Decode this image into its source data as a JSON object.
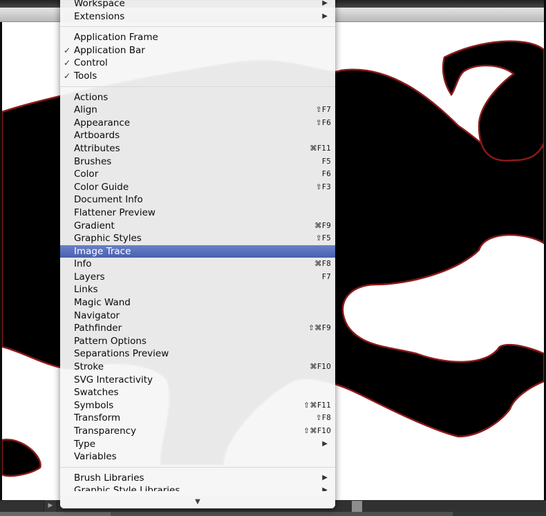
{
  "window": {
    "status_arrow_icon": "▶"
  },
  "menu": {
    "groups": [
      [
        {
          "label": "Workspace",
          "submenu": true
        },
        {
          "label": "Extensions",
          "submenu": true
        }
      ],
      [
        {
          "label": "Application Frame",
          "checked": false
        },
        {
          "label": "Application Bar",
          "checked": true
        },
        {
          "label": "Control",
          "checked": true
        },
        {
          "label": "Tools",
          "checked": true
        }
      ],
      [
        {
          "label": "Actions",
          "shortcut": ""
        },
        {
          "label": "Align",
          "shortcut": "⇧F7"
        },
        {
          "label": "Appearance",
          "shortcut": "⇧F6"
        },
        {
          "label": "Artboards",
          "shortcut": ""
        },
        {
          "label": "Attributes",
          "shortcut": "⌘F11"
        },
        {
          "label": "Brushes",
          "shortcut": "F5"
        },
        {
          "label": "Color",
          "shortcut": "F6"
        },
        {
          "label": "Color Guide",
          "shortcut": "⇧F3"
        },
        {
          "label": "Document Info",
          "shortcut": ""
        },
        {
          "label": "Flattener Preview",
          "shortcut": ""
        },
        {
          "label": "Gradient",
          "shortcut": "⌘F9"
        },
        {
          "label": "Graphic Styles",
          "shortcut": "⇧F5"
        },
        {
          "label": "Image Trace",
          "shortcut": "",
          "highlighted": true
        },
        {
          "label": "Info",
          "shortcut": "⌘F8"
        },
        {
          "label": "Layers",
          "shortcut": "F7"
        },
        {
          "label": "Links",
          "shortcut": ""
        },
        {
          "label": "Magic Wand",
          "shortcut": ""
        },
        {
          "label": "Navigator",
          "shortcut": ""
        },
        {
          "label": "Pathfinder",
          "shortcut": "⇧⌘F9"
        },
        {
          "label": "Pattern Options",
          "shortcut": ""
        },
        {
          "label": "Separations Preview",
          "shortcut": ""
        },
        {
          "label": "Stroke",
          "shortcut": "⌘F10"
        },
        {
          "label": "SVG Interactivity",
          "shortcut": ""
        },
        {
          "label": "Swatches",
          "shortcut": ""
        },
        {
          "label": "Symbols",
          "shortcut": "⇧⌘F11"
        },
        {
          "label": "Transform",
          "shortcut": "⇧F8"
        },
        {
          "label": "Transparency",
          "shortcut": "⇧⌘F10"
        },
        {
          "label": "Type",
          "submenu": true
        },
        {
          "label": "Variables",
          "shortcut": ""
        }
      ],
      [
        {
          "label": "Brush Libraries",
          "submenu": true
        },
        {
          "label": "Graphic Style Libraries",
          "submenu": true,
          "partial": true
        }
      ]
    ],
    "check_glyph": "✓",
    "submenu_glyph": "▶",
    "scroll_down_glyph": "▼"
  },
  "colors": {
    "highlight": "#5068b8",
    "artwork_fill": "#000000",
    "artwork_outline": "#8b1a1a"
  }
}
